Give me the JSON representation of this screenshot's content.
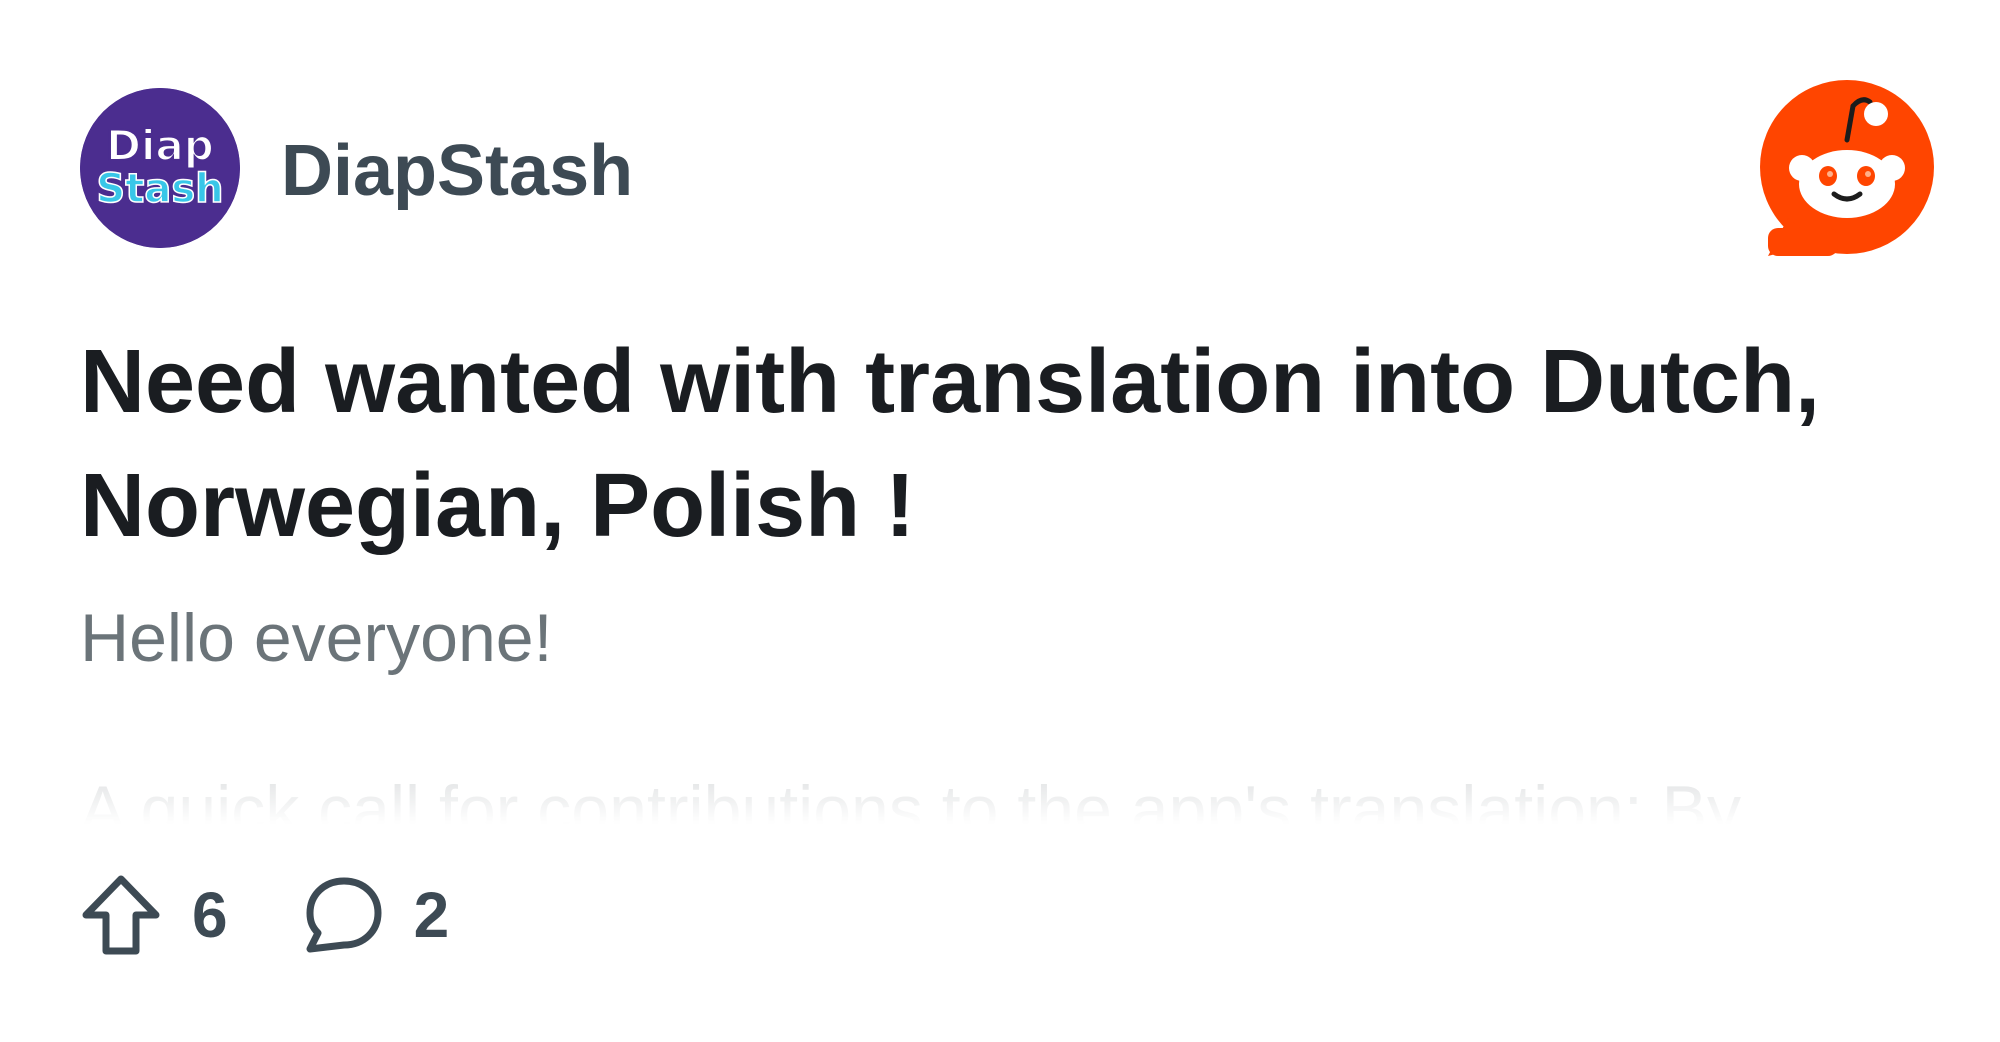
{
  "community": {
    "name": "DiapStash",
    "avatar_text_top": "Diap",
    "avatar_text_bottom": "Stash",
    "avatar_bg": "#4b2d8f",
    "avatar_fg_top": "#ffffff",
    "avatar_fg_bottom": "#38c6e8"
  },
  "brand": {
    "logo_icon": "reddit-logo-icon",
    "color": "#ff4500"
  },
  "post": {
    "title": "Need wanted with translation into Dutch, Norwegian, Polish !",
    "greeting": "Hello everyone!",
    "excerpt": "A quick call for contributions to the app's translation: By"
  },
  "stats": {
    "upvotes": "6",
    "comments": "2",
    "upvote_icon": "upvote-arrow-icon",
    "comment_icon": "comment-bubble-icon"
  }
}
